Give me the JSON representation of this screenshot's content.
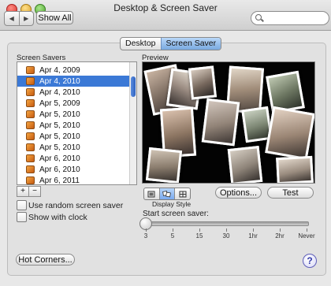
{
  "window": {
    "title": "Desktop & Screen Saver",
    "nav_back": "◀",
    "nav_forward": "▶",
    "show_all": "Show All",
    "search_placeholder": ""
  },
  "tabs": [
    {
      "label": "Desktop",
      "active": false
    },
    {
      "label": "Screen Saver",
      "active": true
    }
  ],
  "screen_savers": {
    "heading": "Screen Savers",
    "items": [
      {
        "label": "Apr 4, 2009",
        "selected": false
      },
      {
        "label": "Apr 4, 2010",
        "selected": true
      },
      {
        "label": "Apr 4, 2010",
        "selected": false
      },
      {
        "label": "Apr 5, 2009",
        "selected": false
      },
      {
        "label": "Apr 5, 2010",
        "selected": false
      },
      {
        "label": "Apr 5, 2010",
        "selected": false
      },
      {
        "label": "Apr 5, 2010",
        "selected": false
      },
      {
        "label": "Apr 5, 2010",
        "selected": false
      },
      {
        "label": "Apr 6, 2010",
        "selected": false
      },
      {
        "label": "Apr 6, 2010",
        "selected": false
      },
      {
        "label": "Apr 6, 2011",
        "selected": false
      }
    ],
    "add_label": "+",
    "remove_label": "−"
  },
  "options": {
    "random_label": "Use random screen saver",
    "clock_label": "Show with clock",
    "random_checked": false,
    "clock_checked": false
  },
  "preview": {
    "heading": "Preview",
    "display_style_label": "Display Style",
    "display_styles": [
      "slideshow-icon",
      "collage-icon",
      "mosaic-icon"
    ],
    "options_button": "Options...",
    "test_button": "Test"
  },
  "start": {
    "label": "Start screen saver:",
    "ticks": [
      "3",
      "5",
      "15",
      "30",
      "1hr",
      "2hr",
      "Never"
    ],
    "value": "3"
  },
  "footer": {
    "hot_corners": "Hot Corners...",
    "help": "?"
  },
  "colors": {
    "selection": "#3b79d6",
    "accent": "#5b8de0"
  }
}
